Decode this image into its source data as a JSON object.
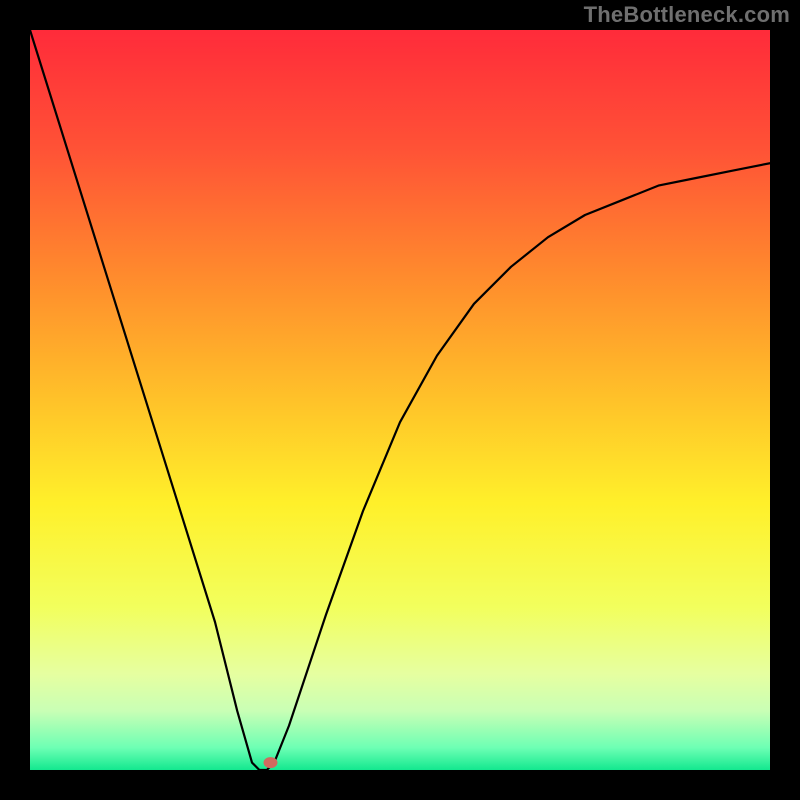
{
  "watermark": "TheBottleneck.com",
  "chart_data": {
    "type": "line",
    "title": "",
    "xlabel": "",
    "ylabel": "",
    "xlim": [
      0,
      100
    ],
    "ylim": [
      0,
      100
    ],
    "grid": false,
    "series": [
      {
        "name": "curve",
        "x": [
          0,
          5,
          10,
          15,
          20,
          25,
          28,
          30,
          31,
          32,
          33,
          35,
          40,
          45,
          50,
          55,
          60,
          65,
          70,
          75,
          80,
          85,
          90,
          95,
          100
        ],
        "y": [
          100,
          84,
          68,
          52,
          36,
          20,
          8,
          1,
          0,
          0,
          1,
          6,
          21,
          35,
          47,
          56,
          63,
          68,
          72,
          75,
          77,
          79,
          80,
          81,
          82
        ]
      }
    ],
    "marker": {
      "x": 32.5,
      "y": 1.0,
      "color": "#d06a5f"
    },
    "gradient_stops": [
      {
        "offset": 0.0,
        "color": "#ff2b3a"
      },
      {
        "offset": 0.16,
        "color": "#ff5236"
      },
      {
        "offset": 0.33,
        "color": "#ff8a2d"
      },
      {
        "offset": 0.5,
        "color": "#ffc229"
      },
      {
        "offset": 0.64,
        "color": "#fff02a"
      },
      {
        "offset": 0.78,
        "color": "#f2ff5d"
      },
      {
        "offset": 0.87,
        "color": "#e6ffa0"
      },
      {
        "offset": 0.92,
        "color": "#c9ffb5"
      },
      {
        "offset": 0.97,
        "color": "#6dffb4"
      },
      {
        "offset": 1.0,
        "color": "#13e88f"
      }
    ]
  }
}
